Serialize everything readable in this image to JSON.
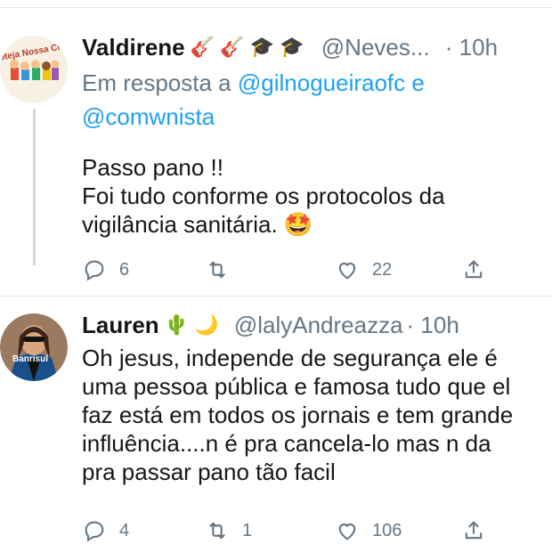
{
  "tweets": [
    {
      "name": "Valdirene",
      "emojis": "🎸 🎸 🎓 🎓",
      "handle": "@Neves...",
      "time": "· 10h",
      "reply_prefix": "Em resposta a",
      "reply_user1": "@gilnogueiraofc",
      "reply_and": "e",
      "reply_user2": "@comwnista",
      "text": "Passo pano !!\nFoi tudo conforme os protocolos da\nvigilância sanitária. 🤩",
      "avatar_text": "Proteja Nossa Crianças",
      "counts": {
        "reply": "6",
        "retweet": "",
        "like": "22"
      }
    },
    {
      "name": "Lauren",
      "emojis": "🌵 🌙",
      "handle": "@lalyAndreazza",
      "time": "· 10h",
      "text": "Oh jesus, independe de segurança ele é\numa pessoa pública e famosa tudo que el\nfaz está em todos os jornais e tem grande\ninfluência....n é pra cancela-lo mas n da\npra passar pano tão facil",
      "avatar_text": "Banrisul",
      "counts": {
        "reply": "4",
        "retweet": "1",
        "like": "106"
      }
    }
  ],
  "colors": {
    "link": "#1da1f2",
    "muted": "#657786",
    "divider": "#e1e8ed"
  },
  "icons": [
    "reply-icon",
    "retweet-icon",
    "like-icon",
    "share-icon"
  ]
}
